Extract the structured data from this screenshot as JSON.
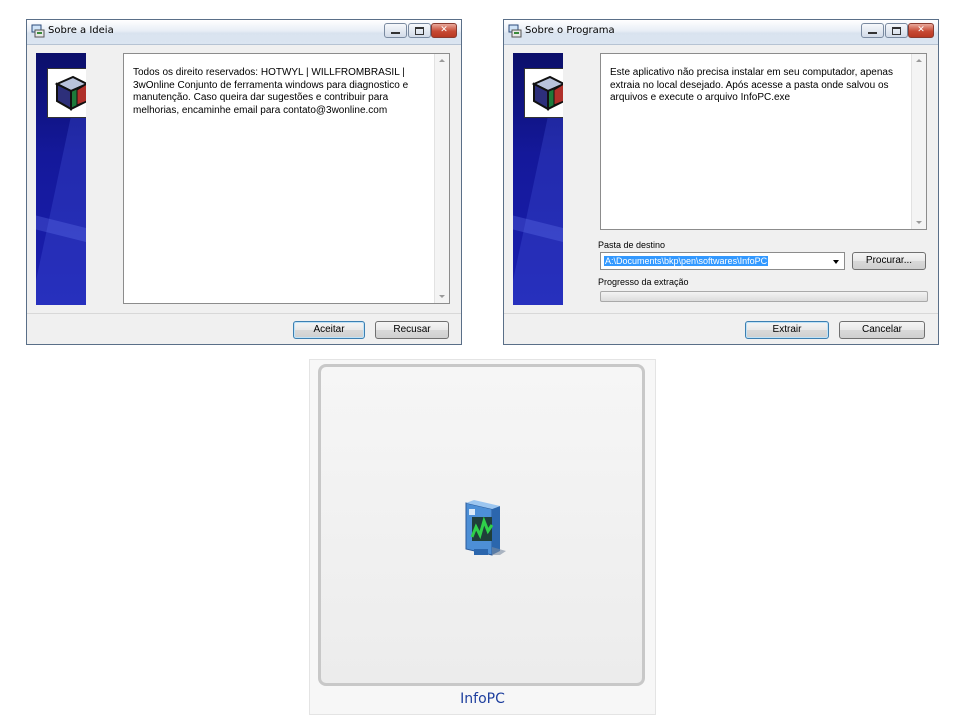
{
  "about_idea": {
    "title": "Sobre a Ideia",
    "text": "Todos os direito reservados: HOTWYL | WILLFROMBRASIL | 3wOnline Conjunto de ferramenta windows para diagnostico e manutenção. Caso queira dar sugestões e contribuir para melhorias, encaminhe email para contato@3wonline.com",
    "accept_label": "Aceitar",
    "refuse_label": "Recusar"
  },
  "about_program": {
    "title": "Sobre o Programa",
    "text": "Este aplicativo não precisa instalar em seu computador, apenas extraia no local desejado. Após acesse a pasta onde salvou os arquivos e execute o arquivo InfoPC.exe",
    "destination_label": "Pasta de destino",
    "destination_value": "A:\\Documents\\bkp\\pen\\softwares\\InfoPC",
    "browse_label": "Procurar...",
    "progress_label": "Progresso da extração",
    "progress_value": 0.0,
    "extract_label": "Extrair",
    "cancel_label": "Cancelar"
  },
  "app_tile": {
    "label": "InfoPC",
    "icon": "infopc-app-icon"
  },
  "colors": {
    "banner": "#14189a",
    "accent_selection": "#3399ff",
    "tile_label": "#1e3f9e",
    "close_button": "#c74a34"
  }
}
